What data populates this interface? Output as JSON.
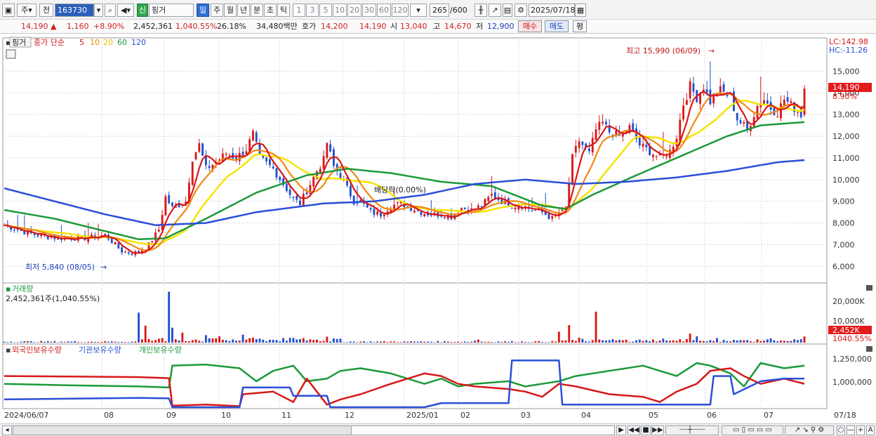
{
  "toolbar": {
    "market_btn": "주",
    "prev_btn": "전",
    "code": "163730",
    "name_badge": "신",
    "stock_name": "핑거",
    "period_active": "일",
    "periods": [
      "주",
      "월",
      "년",
      "분",
      "초",
      "틱"
    ],
    "intervals": [
      "1",
      "3",
      "5",
      "10",
      "20",
      "30",
      "60",
      "120"
    ],
    "count": "265",
    "count_total": "/600",
    "date": "2025/07/18"
  },
  "pricebar": {
    "price": "14,190",
    "change": "1,160",
    "change_pct": "+8.90%",
    "volume": "2,452,361",
    "volume_pct": "1,040.55%",
    "turnover": "26.18%",
    "amount": "34,480백만",
    "ask_label": "호가",
    "ask": "14,200",
    "bid": "14,190",
    "open_label": "시",
    "open": "13,040",
    "high_label": "고",
    "high": "14,670",
    "low_label": "저",
    "low": "12,900",
    "buy_btn": "매수",
    "sell_btn": "매도",
    "eval_btn": "평"
  },
  "chart_data": {
    "type": "candlestick",
    "legend": {
      "name": "핑거",
      "series_label": "종가 단순",
      "ma_periods": [
        "5",
        "10",
        "20",
        "60",
        "120"
      ]
    },
    "colors": {
      "ma5": "#d81818",
      "ma10": "#f08a10",
      "ma20": "#f5e400",
      "ma60": "#1b9a3a",
      "ma120": "#2a4fd6",
      "up": "#d81818",
      "down": "#1f4fd0"
    },
    "lc_label": "LC:142.98",
    "hc_label": "HC:-11.26",
    "y_ticks": [
      "15,000",
      "14,000",
      "13,000",
      "12,000",
      "11,000",
      "10,000",
      "9,000",
      "8,000",
      "7,000",
      "6,000"
    ],
    "y_range": [
      5400,
      16400
    ],
    "current_price_label": "14,190",
    "current_pct_label": "8.90%",
    "annotations": {
      "high": "최고 15,990 (06/09)",
      "low": "최저 5,840 (08/05)",
      "dividend": "배당락(0.00%)"
    },
    "x_labels": [
      "2024/06/07",
      "08",
      "09",
      "10",
      "11",
      "12",
      "2025/01",
      "02",
      "03",
      "04",
      "05",
      "06",
      "07",
      "07/18"
    ],
    "price_path": [
      [
        0,
        7900
      ],
      [
        8,
        7500
      ],
      [
        16,
        7300
      ],
      [
        24,
        7300
      ],
      [
        30,
        7450
      ],
      [
        33,
        7000
      ],
      [
        35,
        6700
      ],
      [
        38,
        6600
      ],
      [
        40,
        6650
      ],
      [
        43,
        7000
      ],
      [
        46,
        7700
      ],
      [
        48,
        9200
      ],
      [
        50,
        8700
      ],
      [
        54,
        9000
      ],
      [
        56,
        11000
      ],
      [
        58,
        11600
      ],
      [
        60,
        10500
      ],
      [
        63,
        10800
      ],
      [
        66,
        11200
      ],
      [
        69,
        11000
      ],
      [
        72,
        11400
      ],
      [
        74,
        12100
      ],
      [
        76,
        11000
      ],
      [
        80,
        10500
      ],
      [
        83,
        9800
      ],
      [
        86,
        9100
      ],
      [
        88,
        8900
      ],
      [
        90,
        9500
      ],
      [
        93,
        10400
      ],
      [
        95,
        10900
      ],
      [
        96,
        11700
      ],
      [
        98,
        10600
      ],
      [
        100,
        10200
      ],
      [
        102,
        9600
      ],
      [
        104,
        9000
      ],
      [
        106,
        9000
      ],
      [
        109,
        8500
      ],
      [
        112,
        8400
      ],
      [
        115,
        8800
      ],
      [
        118,
        8900
      ],
      [
        121,
        8700
      ],
      [
        124,
        8500
      ],
      [
        127,
        8400
      ],
      [
        130,
        8400
      ],
      [
        133,
        8300
      ],
      [
        136,
        8700
      ],
      [
        139,
        8600
      ],
      [
        142,
        8800
      ],
      [
        145,
        9300
      ],
      [
        148,
        9000
      ],
      [
        151,
        8800
      ],
      [
        154,
        8800
      ],
      [
        157,
        8600
      ],
      [
        160,
        8500
      ],
      [
        163,
        8200
      ],
      [
        165,
        8500
      ],
      [
        167,
        8700
      ],
      [
        169,
        11000
      ],
      [
        171,
        11800
      ],
      [
        174,
        11200
      ],
      [
        176,
        12300
      ],
      [
        178,
        12600
      ],
      [
        180,
        12200
      ],
      [
        183,
        12000
      ],
      [
        186,
        12400
      ],
      [
        189,
        11600
      ],
      [
        192,
        11300
      ],
      [
        195,
        11000
      ],
      [
        198,
        11300
      ],
      [
        200,
        12000
      ],
      [
        202,
        13500
      ],
      [
        204,
        14300
      ],
      [
        206,
        13800
      ],
      [
        208,
        14300
      ],
      [
        210,
        13600
      ],
      [
        213,
        14100
      ],
      [
        216,
        13800
      ],
      [
        218,
        12800
      ],
      [
        221,
        12300
      ],
      [
        224,
        13400
      ],
      [
        226,
        13700
      ],
      [
        228,
        13300
      ],
      [
        230,
        13100
      ],
      [
        232,
        13700
      ],
      [
        235,
        13300
      ],
      [
        237,
        13000
      ],
      [
        238,
        14190
      ]
    ],
    "ma60_path": [
      [
        0,
        8600
      ],
      [
        15,
        8200
      ],
      [
        28,
        7700
      ],
      [
        40,
        7250
      ],
      [
        48,
        7300
      ],
      [
        60,
        8200
      ],
      [
        75,
        9400
      ],
      [
        90,
        10200
      ],
      [
        102,
        10500
      ],
      [
        115,
        10300
      ],
      [
        130,
        9900
      ],
      [
        145,
        9700
      ],
      [
        160,
        8800
      ],
      [
        167,
        8650
      ],
      [
        175,
        9300
      ],
      [
        188,
        10200
      ],
      [
        200,
        11000
      ],
      [
        215,
        12000
      ],
      [
        225,
        12500
      ],
      [
        238,
        12650
      ]
    ],
    "ma120_path": [
      [
        0,
        9600
      ],
      [
        15,
        9000
      ],
      [
        30,
        8400
      ],
      [
        45,
        7900
      ],
      [
        60,
        8000
      ],
      [
        75,
        8500
      ],
      [
        95,
        8900
      ],
      [
        110,
        9000
      ],
      [
        125,
        9300
      ],
      [
        140,
        9800
      ],
      [
        155,
        10000
      ],
      [
        170,
        9800
      ],
      [
        185,
        9900
      ],
      [
        200,
        10100
      ],
      [
        215,
        10400
      ],
      [
        230,
        10800
      ],
      [
        238,
        10900
      ]
    ],
    "volume_label": "거래량",
    "volume_value": "2,452,361주(1,040.55%)",
    "volume_ticks": [
      "20,000K",
      "10,000K"
    ],
    "volume_current_label": "2,452K",
    "volume_pct_label": "1040.55%",
    "volume_peaks": [
      [
        40,
        12000
      ],
      [
        42,
        6800
      ],
      [
        49,
        20400
      ],
      [
        50,
        6000
      ],
      [
        53,
        4000
      ],
      [
        60,
        3000
      ],
      [
        64,
        2500
      ],
      [
        71,
        3200
      ],
      [
        74,
        2000
      ],
      [
        83,
        1800
      ],
      [
        88,
        1400
      ],
      [
        96,
        2400
      ],
      [
        100,
        1600
      ],
      [
        120,
        400
      ],
      [
        140,
        800
      ],
      [
        141,
        1200
      ],
      [
        165,
        4400
      ],
      [
        168,
        7000
      ],
      [
        171,
        2000
      ],
      [
        176,
        12400
      ],
      [
        180,
        1000
      ],
      [
        196,
        1600
      ],
      [
        204,
        3600
      ],
      [
        206,
        2500
      ],
      [
        212,
        1800
      ],
      [
        224,
        1300
      ],
      [
        228,
        1700
      ],
      [
        238,
        2452
      ]
    ],
    "flow_legend": [
      "외국인보유수량",
      "기관보유수량",
      "개인보유수량"
    ],
    "flow_ticks": [
      "1,250,000",
      "1,000,000"
    ]
  },
  "bottombar": {
    "nav_buttons": [
      "▶",
      "◀◀",
      "■",
      "▶▶"
    ],
    "zoom_buttons": [
      "○",
      "—",
      "+",
      "A"
    ]
  }
}
